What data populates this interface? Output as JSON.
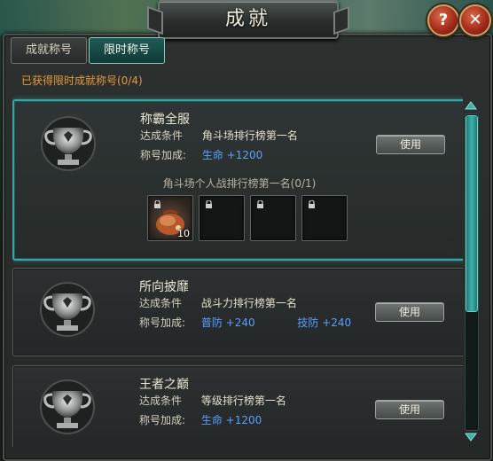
{
  "window": {
    "title": "成就",
    "help_label": "?",
    "close_label": "✕"
  },
  "tabs": [
    {
      "label": "成就称号",
      "active": false
    },
    {
      "label": "限时称号",
      "active": true
    }
  ],
  "summary": "已获得限时成就称号(0/4)",
  "entries": [
    {
      "name": "称霸全服",
      "condition_label": "达成条件",
      "condition": "角斗场排行榜第一名",
      "bonus_label": "称号加成:",
      "bonuses": [
        {
          "stat": "生命",
          "value": "+1200"
        }
      ],
      "use_label": "使用",
      "reward_title": "角斗场个人战排行榜第一名(0/1)",
      "reward_slots": [
        {
          "item": "reward-pouch-icon",
          "count": "10"
        },
        {
          "item": "locked",
          "count": ""
        },
        {
          "item": "locked",
          "count": ""
        },
        {
          "item": "locked",
          "count": ""
        }
      ]
    },
    {
      "name": "所向披靡",
      "condition_label": "达成条件",
      "condition": "战斗力排行榜第一名",
      "bonus_label": "称号加成:",
      "bonuses": [
        {
          "stat": "普防",
          "value": "+240"
        },
        {
          "stat": "技防",
          "value": "+240"
        }
      ],
      "use_label": "使用"
    },
    {
      "name": "王者之巅",
      "condition_label": "达成条件",
      "condition": "等级排行榜第一名",
      "bonus_label": "称号加成:",
      "bonuses": [
        {
          "stat": "生命",
          "value": "+1200"
        }
      ],
      "use_label": "使用"
    }
  ],
  "colors": {
    "accent_teal": "#3aa4a0",
    "summary_orange": "#e89a3a",
    "stat_blue": "#5aa0ff"
  }
}
